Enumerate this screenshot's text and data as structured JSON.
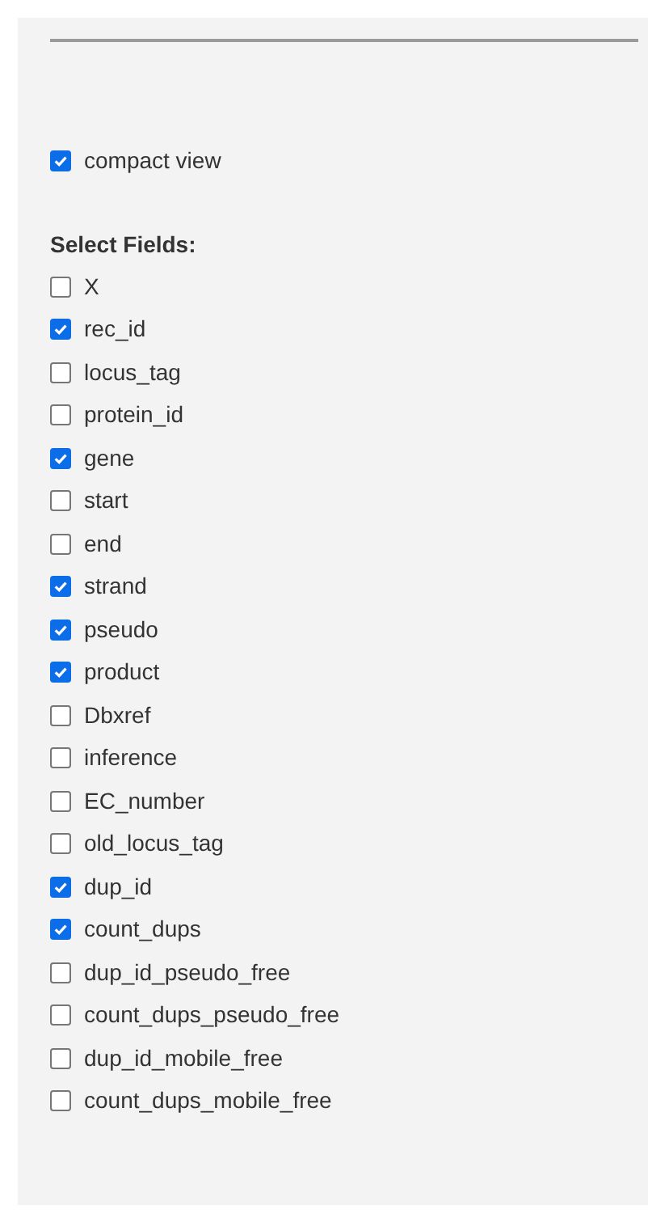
{
  "compact_view": {
    "label": "compact view",
    "checked": true
  },
  "fields_heading": "Select Fields:",
  "fields": [
    {
      "label": "X",
      "checked": false
    },
    {
      "label": "rec_id",
      "checked": true
    },
    {
      "label": "locus_tag",
      "checked": false
    },
    {
      "label": "protein_id",
      "checked": false
    },
    {
      "label": "gene",
      "checked": true
    },
    {
      "label": "start",
      "checked": false
    },
    {
      "label": "end",
      "checked": false
    },
    {
      "label": "strand",
      "checked": true
    },
    {
      "label": "pseudo",
      "checked": true
    },
    {
      "label": "product",
      "checked": true
    },
    {
      "label": "Dbxref",
      "checked": false
    },
    {
      "label": "inference",
      "checked": false
    },
    {
      "label": "EC_number",
      "checked": false
    },
    {
      "label": "old_locus_tag",
      "checked": false
    },
    {
      "label": "dup_id",
      "checked": true
    },
    {
      "label": "count_dups",
      "checked": true
    },
    {
      "label": "dup_id_pseudo_free",
      "checked": false
    },
    {
      "label": "count_dups_pseudo_free",
      "checked": false
    },
    {
      "label": "dup_id_mobile_free",
      "checked": false
    },
    {
      "label": "count_dups_mobile_free",
      "checked": false
    }
  ]
}
